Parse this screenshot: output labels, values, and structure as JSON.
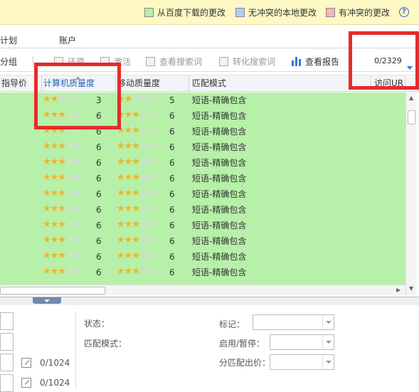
{
  "legend": {
    "items": [
      {
        "label": "从百度下载的更改",
        "color": "#b7f0a9"
      },
      {
        "label": "无冲突的本地更改",
        "color": "#b7c9f5"
      },
      {
        "label": "有冲突的更改",
        "color": "#f5b5b5"
      }
    ],
    "help": "?"
  },
  "tabs": [
    "计划",
    "账户"
  ],
  "toolbar": {
    "group": "分组",
    "restore": "还原",
    "activate": "激活",
    "view_search_terms": "查看搜索词",
    "convert_search_terms": "转化搜索词",
    "view_report": "查看报告",
    "count": "0/2329"
  },
  "columns": {
    "guide_price": "指导价",
    "pc_quality": "计算机质量度",
    "mobile_quality": "移动质量度",
    "match_mode": "匹配模式",
    "visit_url": "访问UR"
  },
  "rows": [
    {
      "pc_stars": 2,
      "pc": "3",
      "mobile_stars": 2,
      "mobile": "5",
      "match": "短语-精确包含"
    },
    {
      "pc_stars": 3,
      "pc": "6",
      "mobile_stars": 3,
      "mobile": "6",
      "match": "短语-精确包含"
    },
    {
      "pc_stars": 3,
      "pc": "6",
      "mobile_stars": 3,
      "mobile": "6",
      "match": "短语-精确包含"
    },
    {
      "pc_stars": 3,
      "pc": "6",
      "mobile_stars": 3,
      "mobile": "6",
      "match": "短语-精确包含"
    },
    {
      "pc_stars": 3,
      "pc": "6",
      "mobile_stars": 3,
      "mobile": "6",
      "match": "短语-精确包含"
    },
    {
      "pc_stars": 3,
      "pc": "6",
      "mobile_stars": 3,
      "mobile": "6",
      "match": "短语-精确包含"
    },
    {
      "pc_stars": 3,
      "pc": "6",
      "mobile_stars": 3,
      "mobile": "6",
      "match": "短语-精确包含"
    },
    {
      "pc_stars": 3,
      "pc": "6",
      "mobile_stars": 3,
      "mobile": "6",
      "match": "短语-精确包含"
    },
    {
      "pc_stars": 3,
      "pc": "6",
      "mobile_stars": 3,
      "mobile": "6",
      "match": "短语-精确包含"
    },
    {
      "pc_stars": 3,
      "pc": "6",
      "mobile_stars": 3,
      "mobile": "6",
      "match": "短语-精确包含"
    },
    {
      "pc_stars": 3,
      "pc": "6",
      "mobile_stars": 3,
      "mobile": "6",
      "match": "短语-精确包含"
    },
    {
      "pc_stars": 3,
      "pc": "6",
      "mobile_stars": 3,
      "mobile": "6",
      "match": "短语-精确包含"
    }
  ],
  "details": {
    "status_label": "状态：",
    "match_mode_label": "匹配模式：",
    "tag_label": "标记：",
    "enable_pause_label": "启用/暂停：",
    "group_bid_label": "分匹配出价：",
    "char_count_1": "0/1024",
    "char_count_2": "0/1024"
  },
  "highlight_color": "#e52b2b"
}
